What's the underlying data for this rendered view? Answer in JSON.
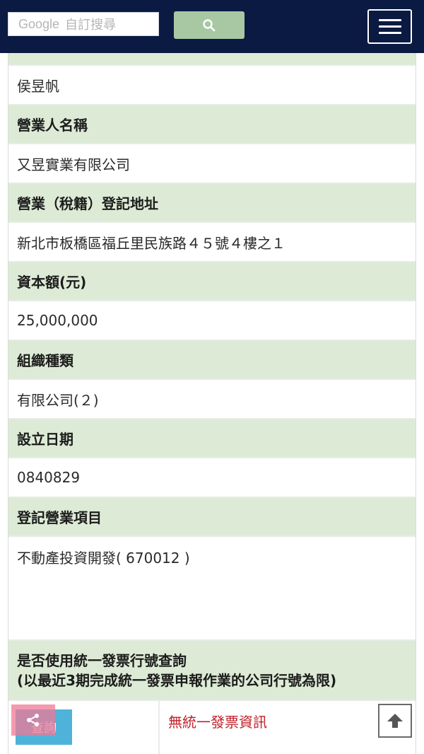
{
  "header": {
    "search_brand": "Google",
    "search_placeholder": "自訂搜尋",
    "search_icon": "search-icon",
    "menu_icon": "hamburger-menu-icon"
  },
  "rows": {
    "responsible_value": "侯昱帆",
    "company_name_label": "營業人名稱",
    "company_name_value": "又昱實業有限公司",
    "address_label": "營業（稅籍）登記地址",
    "address_value": "新北市板橋區福丘里民族路４５號４樓之１",
    "capital_label": "資本額(元)",
    "capital_value": "25,000,000",
    "org_type_label": "組織種類",
    "org_type_value": "有限公司(２)",
    "founded_label": "設立日期",
    "founded_value": "0840829",
    "business_items_label": "登記營業項目",
    "business_items_value": "不動產投資開發( 670012 )",
    "invoice_label_line1": "是否使用統一發票行號查詢",
    "invoice_label_line2": "(以最近3期完成統一發票申報作業的公司行號為限)"
  },
  "bottom": {
    "query_button_label": "查詢",
    "invoice_result": "無統一發票資訊"
  },
  "colors": {
    "topbar": "#0b1a42",
    "header_row": "#ddebd6",
    "alert_text": "#c0202a",
    "query_button": "#4fb3d9"
  }
}
